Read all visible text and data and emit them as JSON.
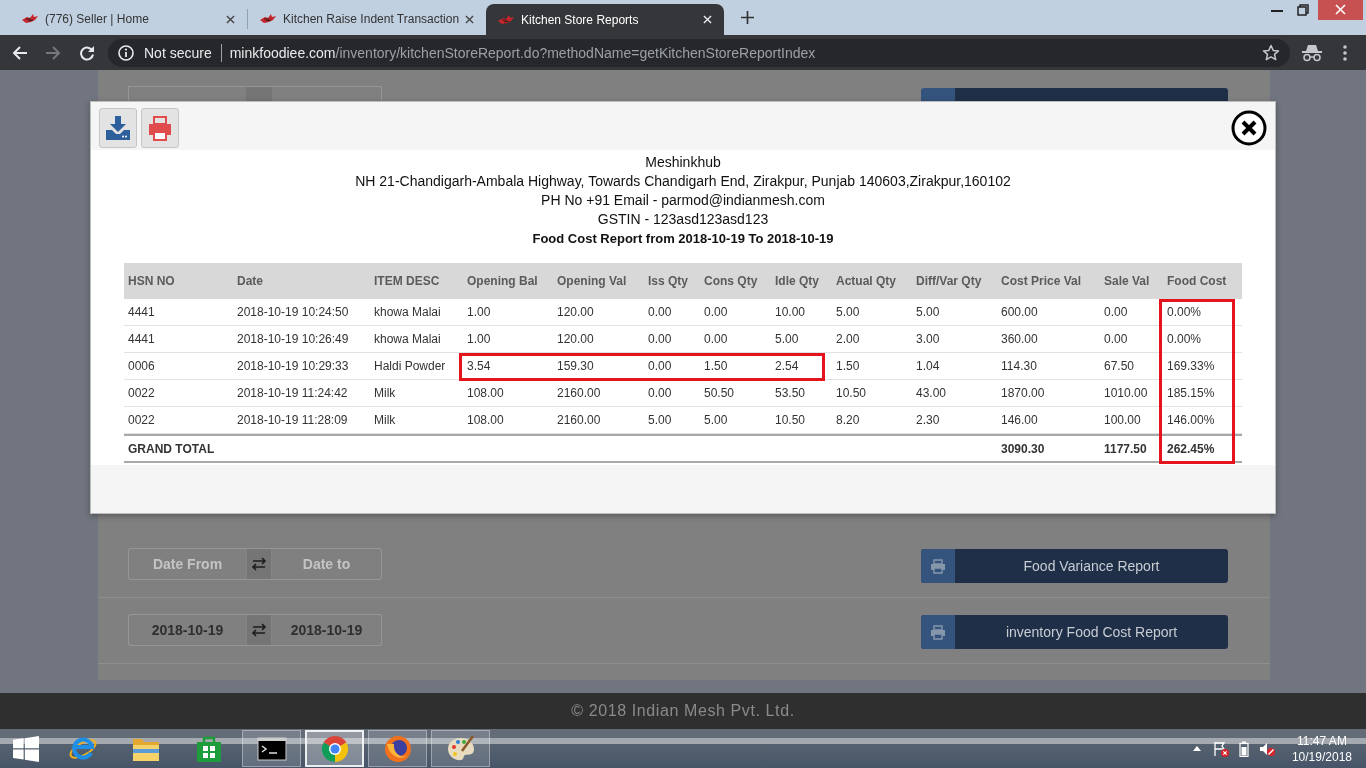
{
  "browser": {
    "tabs": [
      {
        "title": "(776) Seller | Home",
        "selected": false
      },
      {
        "title": "Kitchen Raise Indent Transaction",
        "selected": false
      },
      {
        "title": "Kitchen Store Reports",
        "selected": true
      }
    ],
    "address_bar": {
      "security_label": "Not secure",
      "host": "minkfoodiee.com",
      "path": "/inventory/kitchenStoreReport.do?methodName=getKitchenStoreReportIndex"
    }
  },
  "page": {
    "report_rows": [
      {
        "date_from": {
          "placeholder": "Date From"
        },
        "date_to": {
          "placeholder": "Date to"
        },
        "button": "Food Variance Report"
      },
      {
        "date_from": {
          "value": "2018-10-19"
        },
        "date_to": {
          "value": "2018-10-19"
        },
        "button": "inventory Food Cost Report"
      }
    ],
    "footer": "© 2018 Indian Mesh Pvt. Ltd."
  },
  "modal": {
    "company": "Meshinkhub",
    "address": "NH 21-Chandigarh-Ambala Highway, Towards Chandigarh End, Zirakpur, Punjab 140603,Zirakpur,160102",
    "contact": "PH No +91 Email - parmod@indianmesh.com",
    "gstin": "GSTIN - 123asd123asd123",
    "title": "Food Cost Report from 2018-10-19 To 2018-10-19",
    "table": {
      "columns": [
        "HSN NO",
        "Date",
        "ITEM DESC",
        "Opening Bal",
        "Opening Val",
        "Iss Qty",
        "Cons Qty",
        "Idle Qty",
        "Actual Qty",
        "Diff/Var Qty",
        "Cost Price Val",
        "Sale Val",
        "Food Cost"
      ],
      "rows": [
        {
          "cells": [
            {
              "text": "4441",
              "boxed": false
            },
            {
              "text": "2018-10-19 10:24:50",
              "boxed": false
            },
            {
              "text": "khowa Malai",
              "boxed": false
            },
            {
              "text": "1.00",
              "boxed": false
            },
            {
              "text": "120.00",
              "boxed": false
            },
            {
              "text": "0.00",
              "boxed": false
            },
            {
              "text": "0.00",
              "boxed": false
            },
            {
              "text": "10.00",
              "boxed": false
            },
            {
              "text": "5.00",
              "boxed": false
            },
            {
              "text": "5.00",
              "boxed": false
            },
            {
              "text": "600.00",
              "boxed": false
            },
            {
              "text": "0.00",
              "boxed": false
            },
            {
              "text": "0.00%",
              "boxed": true
            }
          ]
        },
        {
          "cells": [
            {
              "text": "4441",
              "boxed": false
            },
            {
              "text": "2018-10-19 10:26:49",
              "boxed": false
            },
            {
              "text": "khowa Malai",
              "boxed": false
            },
            {
              "text": "1.00",
              "boxed": false
            },
            {
              "text": "120.00",
              "boxed": false
            },
            {
              "text": "0.00",
              "boxed": false
            },
            {
              "text": "0.00",
              "boxed": false
            },
            {
              "text": "5.00",
              "boxed": false
            },
            {
              "text": "2.00",
              "boxed": false
            },
            {
              "text": "3.00",
              "boxed": false
            },
            {
              "text": "360.00",
              "boxed": false
            },
            {
              "text": "0.00",
              "boxed": false
            },
            {
              "text": "0.00%",
              "boxed": true
            }
          ]
        },
        {
          "cells": [
            {
              "text": "0006",
              "boxed": false
            },
            {
              "text": "2018-10-19 10:29:33",
              "boxed": false
            },
            {
              "text": "Haldi Powder",
              "boxed": false
            },
            {
              "text": "3.54",
              "boxed": true
            },
            {
              "text": "159.30",
              "boxed": true
            },
            {
              "text": "0.00",
              "boxed": true
            },
            {
              "text": "1.50",
              "boxed": true
            },
            {
              "text": "2.54",
              "boxed": true
            },
            {
              "text": "1.50",
              "boxed": false
            },
            {
              "text": "1.04",
              "boxed": false
            },
            {
              "text": "114.30",
              "boxed": false
            },
            {
              "text": "67.50",
              "boxed": false
            },
            {
              "text": "169.33%",
              "boxed": true
            }
          ]
        },
        {
          "cells": [
            {
              "text": "0022",
              "boxed": false
            },
            {
              "text": "2018-10-19 11:24:42",
              "boxed": false
            },
            {
              "text": "Milk",
              "boxed": false
            },
            {
              "text": "108.00",
              "boxed": false
            },
            {
              "text": "2160.00",
              "boxed": false
            },
            {
              "text": "0.00",
              "boxed": false
            },
            {
              "text": "50.50",
              "boxed": false
            },
            {
              "text": "53.50",
              "boxed": false
            },
            {
              "text": "10.50",
              "boxed": false
            },
            {
              "text": "43.00",
              "boxed": false
            },
            {
              "text": "1870.00",
              "boxed": false
            },
            {
              "text": "1010.00",
              "boxed": false
            },
            {
              "text": "185.15%",
              "boxed": true
            }
          ]
        },
        {
          "cells": [
            {
              "text": "0022",
              "boxed": false
            },
            {
              "text": "2018-10-19 11:28:09",
              "boxed": false
            },
            {
              "text": "Milk",
              "boxed": false
            },
            {
              "text": "108.00",
              "boxed": false
            },
            {
              "text": "2160.00",
              "boxed": false
            },
            {
              "text": "5.00",
              "boxed": false
            },
            {
              "text": "5.00",
              "boxed": false
            },
            {
              "text": "10.50",
              "boxed": false
            },
            {
              "text": "8.20",
              "boxed": false
            },
            {
              "text": "2.30",
              "boxed": false
            },
            {
              "text": "146.00",
              "boxed": false
            },
            {
              "text": "100.00",
              "boxed": false
            },
            {
              "text": "146.00%",
              "boxed": true
            }
          ]
        }
      ],
      "total": {
        "label": "GRAND TOTAL",
        "cost_price_val": {
          "text": "3090.30",
          "boxed": false
        },
        "sale_val": {
          "text": "1177.50",
          "boxed": false
        },
        "food_cost": {
          "text": "262.45%",
          "boxed": true
        }
      }
    }
  },
  "taskbar": {
    "apps": [
      {
        "kind": "e-browser",
        "running": false,
        "selected": false
      },
      {
        "kind": "folder",
        "running": false,
        "selected": false
      },
      {
        "kind": "store",
        "running": false,
        "selected": false
      },
      {
        "kind": "terminal",
        "running": true,
        "selected": false
      },
      {
        "kind": "ring-browser",
        "running": true,
        "selected": true
      },
      {
        "kind": "fox-browser",
        "running": true,
        "selected": false
      },
      {
        "kind": "palette",
        "running": true,
        "selected": false
      }
    ],
    "clock": {
      "time": "11:47 AM",
      "date": "10/19/2018"
    }
  }
}
